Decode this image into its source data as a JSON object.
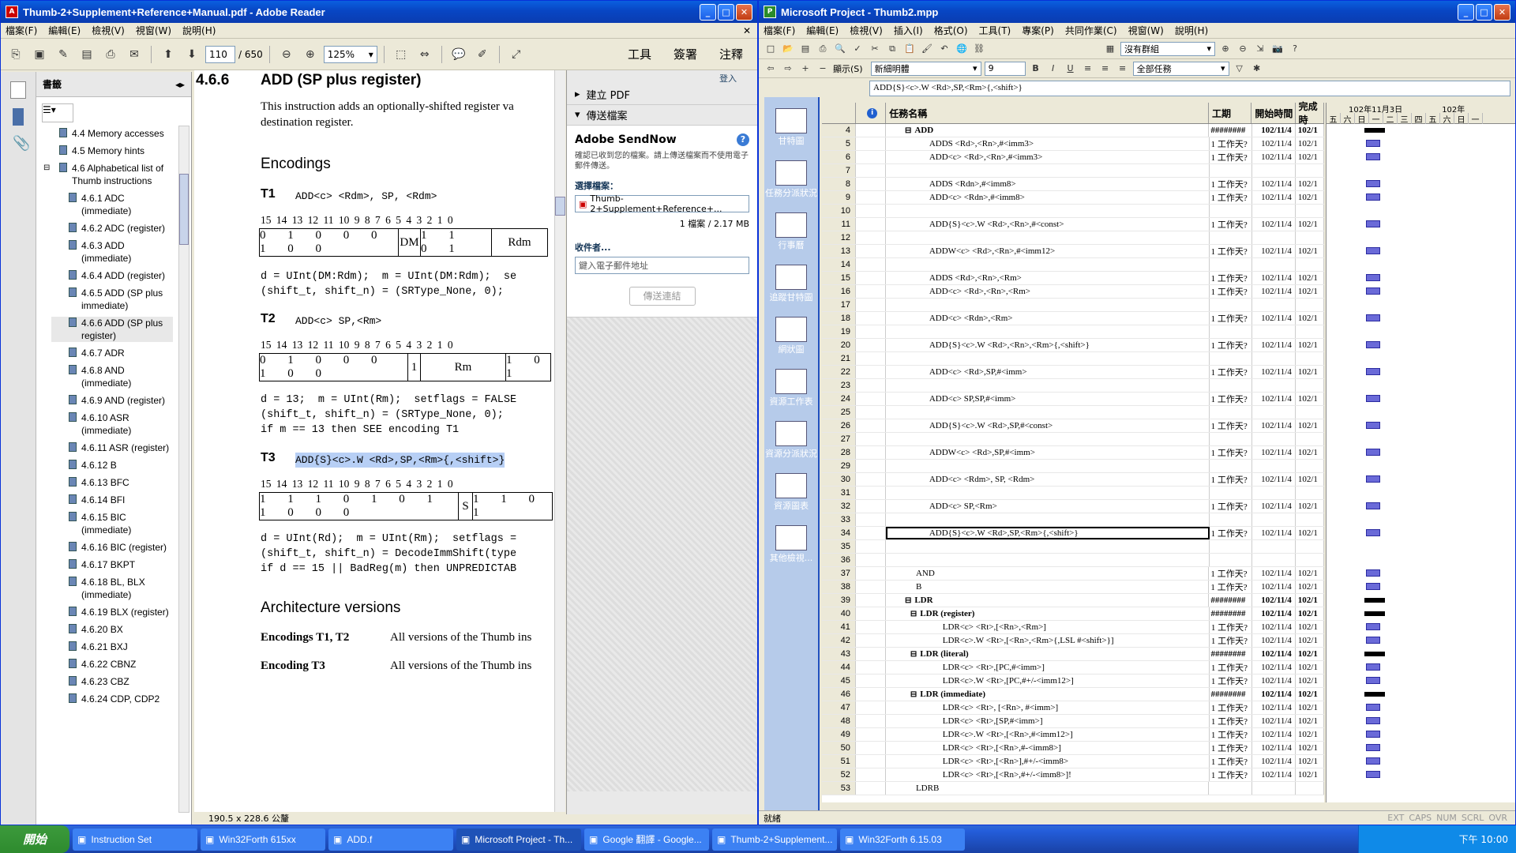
{
  "adobe": {
    "title": "Thumb-2+Supplement+Reference+Manual.pdf - Adobe Reader",
    "menu": [
      "檔案(F)",
      "編輯(E)",
      "檢視(V)",
      "視窗(W)",
      "說明(H)"
    ],
    "page_current": "110",
    "page_total": "/ 650",
    "zoom": "125%",
    "tools_tabs": [
      "工具",
      "簽署",
      "注釋"
    ],
    "bookmarks_title": "書籤",
    "bookmarks": [
      "4.4 Memory accesses",
      "4.5 Memory hints",
      "4.6 Alphabetical list of Thumb instructions",
      "4.6.1 ADC (immediate)",
      "4.6.2 ADC (register)",
      "4.6.3 ADD (immediate)",
      "4.6.4 ADD (register)",
      "4.6.5 ADD (SP plus immediate)",
      "4.6.6 ADD (SP plus register)",
      "4.6.7 ADR",
      "4.6.8 AND (immediate)",
      "4.6.9 AND (register)",
      "4.6.10 ASR (immediate)",
      "4.6.11 ASR (register)",
      "4.6.12 B",
      "4.6.13 BFC",
      "4.6.14 BFI",
      "4.6.15 BIC (immediate)",
      "4.6.16 BIC (register)",
      "4.6.17 BKPT",
      "4.6.18 BL, BLX (immediate)",
      "4.6.19 BLX (register)",
      "4.6.20 BX",
      "4.6.21 BXJ",
      "4.6.22 CBNZ",
      "4.6.23 CBZ",
      "4.6.24 CDP, CDP2"
    ],
    "doc": {
      "section_num": "4.6.6",
      "section_title": "ADD (SP plus register)",
      "intro1": "This instruction adds an optionally-shifted register va",
      "intro2": "destination register.",
      "encodings_heading": "Encodings",
      "t1_label": "T1",
      "t1_syntax": "ADD<c> <Rdm>, SP, <Rdm>",
      "bitnums": "15 14 13 12 11 10 9  8   7   6  5  4  3  2  1  0",
      "t1_bits_a": "0 1 0 0 0 1 0 0",
      "t1_dm": "DM",
      "t1_bits_b": "1 1 0 1",
      "t1_rdm": "Rdm",
      "t1_code1": "d = UInt(DM:Rdm);  m = UInt(DM:Rdm);  se",
      "t1_code2": "(shift_t, shift_n) = (SRType_None, 0);",
      "t2_label": "T2",
      "t2_syntax": "ADD<c> SP,<Rm>",
      "t2_bits_a": "0 1 0 0 0 1 0 0",
      "t2_one": "1",
      "t2_rm": "Rm",
      "t2_bits_b": "1 0 1",
      "t2_code1": "d = 13;  m = UInt(Rm);  setflags = FALSE",
      "t2_code2": "(shift_t, shift_n) = (SRType_None, 0);",
      "t2_code3": "if m == 13 then SEE encoding T1",
      "t3_label": "T3",
      "t3_syntax": "ADD{S}<c>.W <Rd>,SP,<Rm>{,<shift>}",
      "t3_bits_a": "1 1 1 0 1 0 1 1 0 0 0",
      "t3_s": "S",
      "t3_bits_b": "1 1 0 1",
      "t3_code1": "d = UInt(Rd);  m = UInt(Rm);  setflags =",
      "t3_code2": "(shift_t, shift_n) = DecodeImmShift(type",
      "t3_code3": "if d == 15 || BadReg(m) then UNPREDICTAB",
      "arch_heading": "Architecture versions",
      "arch_row1_label": "Encodings T1, T2",
      "arch_row1_text": "All versions of the Thumb ins",
      "arch_row2_label": "Encoding T3",
      "arch_row2_text": "All versions of the Thumb ins"
    },
    "page_size": "190.5 x 228.6 公釐",
    "send": {
      "login": "登入",
      "create_pdf": "建立 PDF",
      "send_files": "傳送檔案",
      "service": "Adobe SendNow",
      "desc": "確認已收到您的檔案。請上傳送檔案而不使用電子郵件傳送。",
      "choose_file": "選擇檔案：",
      "file_name": "Thumb-2+Supplement+Reference+...",
      "file_count": "1 檔案 / 2.17 MB",
      "recipient": "收件者...",
      "email_placeholder": "鍵入電子郵件地址",
      "send_button": "傳送連結"
    }
  },
  "project": {
    "title": "Microsoft Project - Thumb2.mpp",
    "menu": [
      "檔案(F)",
      "編輯(E)",
      "檢視(V)",
      "插入(I)",
      "格式(O)",
      "工具(T)",
      "專案(P)",
      "共同作業(C)",
      "視窗(W)",
      "說明(H)"
    ],
    "group": "沒有群組",
    "font": "新細明體",
    "font_size": "9",
    "filter": "全部任務",
    "show_label": "顯示(S)",
    "entry_bar": "ADD{S}<c>.W <Rd>,SP,<Rm>{,<shift>}",
    "views": [
      "甘特圖",
      "任務分派狀況",
      "行事曆",
      "追蹤甘特圖",
      "網狀圖",
      "資源工作表",
      "資源分派狀況",
      "資源圖表",
      "其他檢視..."
    ],
    "headers": {
      "name": "任務名稱",
      "duration": "工期",
      "start": "開始時間",
      "finish": "完成時"
    },
    "gantt_header": "102年11月3日",
    "gantt_header2": "102年",
    "weekdays": [
      "五",
      "六",
      "日",
      "一",
      "二",
      "三",
      "四",
      "五",
      "六",
      "日",
      "一"
    ],
    "rows": [
      {
        "id": "4",
        "name": "ADD",
        "indent": 1,
        "bold": true,
        "summary": true,
        "dur": "########",
        "start": "102/11/4",
        "fin": "102/1"
      },
      {
        "id": "5",
        "name": "ADDS <Rd>,<Rn>,#<imm3>",
        "indent": 2,
        "dur": "1 工作天?",
        "start": "102/11/4",
        "fin": "102/1"
      },
      {
        "id": "6",
        "name": "ADD<c> <Rd>,<Rn>,#<imm3>",
        "indent": 2,
        "dur": "1 工作天?",
        "start": "102/11/4",
        "fin": "102/1"
      },
      {
        "id": "7",
        "name": "",
        "indent": 2,
        "dur": "",
        "start": "",
        "fin": ""
      },
      {
        "id": "8",
        "name": "ADDS <Rdn>,#<imm8>",
        "indent": 2,
        "dur": "1 工作天?",
        "start": "102/11/4",
        "fin": "102/1"
      },
      {
        "id": "9",
        "name": "ADD<c> <Rdn>,#<imm8>",
        "indent": 2,
        "dur": "1 工作天?",
        "start": "102/11/4",
        "fin": "102/1"
      },
      {
        "id": "10",
        "name": "",
        "indent": 2,
        "dur": "",
        "start": "",
        "fin": ""
      },
      {
        "id": "11",
        "name": "ADD{S}<c>.W <Rd>,<Rn>,#<const>",
        "indent": 2,
        "dur": "1 工作天?",
        "start": "102/11/4",
        "fin": "102/1"
      },
      {
        "id": "12",
        "name": "",
        "indent": 2,
        "dur": "",
        "start": "",
        "fin": ""
      },
      {
        "id": "13",
        "name": "ADDW<c> <Rd>,<Rn>,#<imm12>",
        "indent": 2,
        "dur": "1 工作天?",
        "start": "102/11/4",
        "fin": "102/1"
      },
      {
        "id": "14",
        "name": "",
        "indent": 2,
        "dur": "",
        "start": "",
        "fin": ""
      },
      {
        "id": "15",
        "name": "ADDS <Rd>,<Rn>,<Rm>",
        "indent": 2,
        "dur": "1 工作天?",
        "start": "102/11/4",
        "fin": "102/1"
      },
      {
        "id": "16",
        "name": "ADD<c> <Rd>,<Rn>,<Rm>",
        "indent": 2,
        "dur": "1 工作天?",
        "start": "102/11/4",
        "fin": "102/1"
      },
      {
        "id": "17",
        "name": "",
        "indent": 2,
        "dur": "",
        "start": "",
        "fin": ""
      },
      {
        "id": "18",
        "name": "ADD<c> <Rdn>,<Rm>",
        "indent": 2,
        "dur": "1 工作天?",
        "start": "102/11/4",
        "fin": "102/1"
      },
      {
        "id": "19",
        "name": "",
        "indent": 2,
        "dur": "",
        "start": "",
        "fin": ""
      },
      {
        "id": "20",
        "name": "ADD{S}<c>.W <Rd>,<Rn>,<Rm>{,<shift>}",
        "indent": 2,
        "dur": "1 工作天?",
        "start": "102/11/4",
        "fin": "102/1"
      },
      {
        "id": "21",
        "name": "",
        "indent": 2,
        "dur": "",
        "start": "",
        "fin": ""
      },
      {
        "id": "22",
        "name": "ADD<c> <Rd>,SP,#<imm>",
        "indent": 2,
        "dur": "1 工作天?",
        "start": "102/11/4",
        "fin": "102/1"
      },
      {
        "id": "23",
        "name": "",
        "indent": 2,
        "dur": "",
        "start": "",
        "fin": ""
      },
      {
        "id": "24",
        "name": "ADD<c> SP,SP,#<imm>",
        "indent": 2,
        "dur": "1 工作天?",
        "start": "102/11/4",
        "fin": "102/1"
      },
      {
        "id": "25",
        "name": "",
        "indent": 2,
        "dur": "",
        "start": "",
        "fin": ""
      },
      {
        "id": "26",
        "name": "ADD{S}<c>.W <Rd>,SP,#<const>",
        "indent": 2,
        "dur": "1 工作天?",
        "start": "102/11/4",
        "fin": "102/1"
      },
      {
        "id": "27",
        "name": "",
        "indent": 2,
        "dur": "",
        "start": "",
        "fin": ""
      },
      {
        "id": "28",
        "name": "ADDW<c> <Rd>,SP,#<imm>",
        "indent": 2,
        "dur": "1 工作天?",
        "start": "102/11/4",
        "fin": "102/1"
      },
      {
        "id": "29",
        "name": "",
        "indent": 2,
        "dur": "",
        "start": "",
        "fin": ""
      },
      {
        "id": "30",
        "name": "ADD<c> <Rdm>, SP, <Rdm>",
        "indent": 2,
        "dur": "1 工作天?",
        "start": "102/11/4",
        "fin": "102/1"
      },
      {
        "id": "31",
        "name": "",
        "indent": 2,
        "dur": "",
        "start": "",
        "fin": ""
      },
      {
        "id": "32",
        "name": "ADD<c> SP,<Rm>",
        "indent": 2,
        "dur": "1 工作天?",
        "start": "102/11/4",
        "fin": "102/1"
      },
      {
        "id": "33",
        "name": "",
        "indent": 2,
        "dur": "",
        "start": "",
        "fin": ""
      },
      {
        "id": "34",
        "name": "ADD{S}<c>.W <Rd>,SP,<Rm>{,<shift>}",
        "indent": 2,
        "selected": true,
        "dur": "1 工作天?",
        "start": "102/11/4",
        "fin": "102/1"
      },
      {
        "id": "35",
        "name": "",
        "indent": 2,
        "dur": "",
        "start": "",
        "fin": ""
      },
      {
        "id": "36",
        "name": "",
        "indent": 2,
        "dur": "",
        "start": "",
        "fin": ""
      },
      {
        "id": "37",
        "name": "AND",
        "indent": 1,
        "dur": "1 工作天?",
        "start": "102/11/4",
        "fin": "102/1"
      },
      {
        "id": "38",
        "name": "B",
        "indent": 1,
        "dur": "1 工作天?",
        "start": "102/11/4",
        "fin": "102/1"
      },
      {
        "id": "39",
        "name": "LDR",
        "indent": 1,
        "bold": true,
        "summary": true,
        "dur": "########",
        "start": "102/11/4",
        "fin": "102/1"
      },
      {
        "id": "40",
        "name": "LDR (register)",
        "indent": 2,
        "bold": true,
        "summary": true,
        "dur": "########",
        "start": "102/11/4",
        "fin": "102/1"
      },
      {
        "id": "41",
        "name": "LDR<c> <Rt>,[<Rn>,<Rm>]",
        "indent": 3,
        "dur": "1 工作天?",
        "start": "102/11/4",
        "fin": "102/1"
      },
      {
        "id": "42",
        "name": "LDR<c>.W <Rt>,[<Rn>,<Rm>{,LSL #<shift>}]",
        "indent": 3,
        "dur": "1 工作天?",
        "start": "102/11/4",
        "fin": "102/1"
      },
      {
        "id": "43",
        "name": "LDR (literal)",
        "indent": 2,
        "bold": true,
        "summary": true,
        "dur": "########",
        "start": "102/11/4",
        "fin": "102/1"
      },
      {
        "id": "44",
        "name": "LDR<c> <Rt>,[PC,#<imm>]",
        "indent": 3,
        "dur": "1 工作天?",
        "start": "102/11/4",
        "fin": "102/1"
      },
      {
        "id": "45",
        "name": "LDR<c>.W <Rt>,[PC,#+/-<imm12>]",
        "indent": 3,
        "dur": "1 工作天?",
        "start": "102/11/4",
        "fin": "102/1"
      },
      {
        "id": "46",
        "name": "LDR (immediate)",
        "indent": 2,
        "bold": true,
        "summary": true,
        "dur": "########",
        "start": "102/11/4",
        "fin": "102/1"
      },
      {
        "id": "47",
        "name": "LDR<c> <Rt>, [<Rn>, #<imm>]",
        "indent": 3,
        "dur": "1 工作天?",
        "start": "102/11/4",
        "fin": "102/1"
      },
      {
        "id": "48",
        "name": "LDR<c> <Rt>,[SP,#<imm>]",
        "indent": 3,
        "dur": "1 工作天?",
        "start": "102/11/4",
        "fin": "102/1"
      },
      {
        "id": "49",
        "name": "LDR<c>.W <Rt>,[<Rn>,#<imm12>]",
        "indent": 3,
        "dur": "1 工作天?",
        "start": "102/11/4",
        "fin": "102/1"
      },
      {
        "id": "50",
        "name": "LDR<c> <Rt>,[<Rn>,#-<imm8>]",
        "indent": 3,
        "dur": "1 工作天?",
        "start": "102/11/4",
        "fin": "102/1"
      },
      {
        "id": "51",
        "name": "LDR<c> <Rt>,[<Rn>],#+/-<imm8>",
        "indent": 3,
        "dur": "1 工作天?",
        "start": "102/11/4",
        "fin": "102/1"
      },
      {
        "id": "52",
        "name": "LDR<c> <Rt>,[<Rn>,#+/-<imm8>]!",
        "indent": 3,
        "dur": "1 工作天?",
        "start": "102/11/4",
        "fin": "102/1"
      },
      {
        "id": "53",
        "name": "LDRB",
        "indent": 1,
        "dur": "",
        "start": "",
        "fin": ""
      }
    ],
    "status": "就緒",
    "status_keys": [
      "EXT",
      "CAPS",
      "NUM",
      "SCRL",
      "OVR"
    ]
  },
  "taskbar": {
    "start": "開始",
    "tasks": [
      "Instruction Set",
      "Win32Forth 615xx",
      "ADD.f",
      "Microsoft Project - Th...",
      "Google 翻譯 - Google...",
      "Thumb-2+Supplement...",
      "Win32Forth 6.15.03"
    ],
    "clock": "下午 10:00"
  },
  "colors": {
    "xp_blue": "#0a5fdf",
    "gantt_bar": "#6a6ad8",
    "highlight": "#b7cff5"
  }
}
